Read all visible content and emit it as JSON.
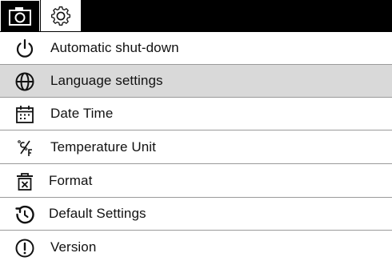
{
  "tabs": [
    {
      "icon": "camera-icon",
      "active": false
    },
    {
      "icon": "gear-icon",
      "active": true
    }
  ],
  "menu": {
    "selected_index": 1,
    "items": [
      {
        "label": "Automatic shut-down",
        "icon": "power-icon"
      },
      {
        "label": "Language settings",
        "icon": "globe-icon"
      },
      {
        "label": "Date Time",
        "icon": "calendar-icon"
      },
      {
        "label": "Temperature Unit",
        "icon": "temperature-unit-icon"
      },
      {
        "label": "Format",
        "icon": "trash-icon"
      },
      {
        "label": "Default Settings",
        "icon": "reset-icon"
      },
      {
        "label": "Version",
        "icon": "info-exclamation-icon"
      }
    ]
  },
  "colors": {
    "tabbar_background": "#000000",
    "selected_row": "#d9d9d9",
    "divider": "#9a9a9a",
    "text": "#111111"
  }
}
